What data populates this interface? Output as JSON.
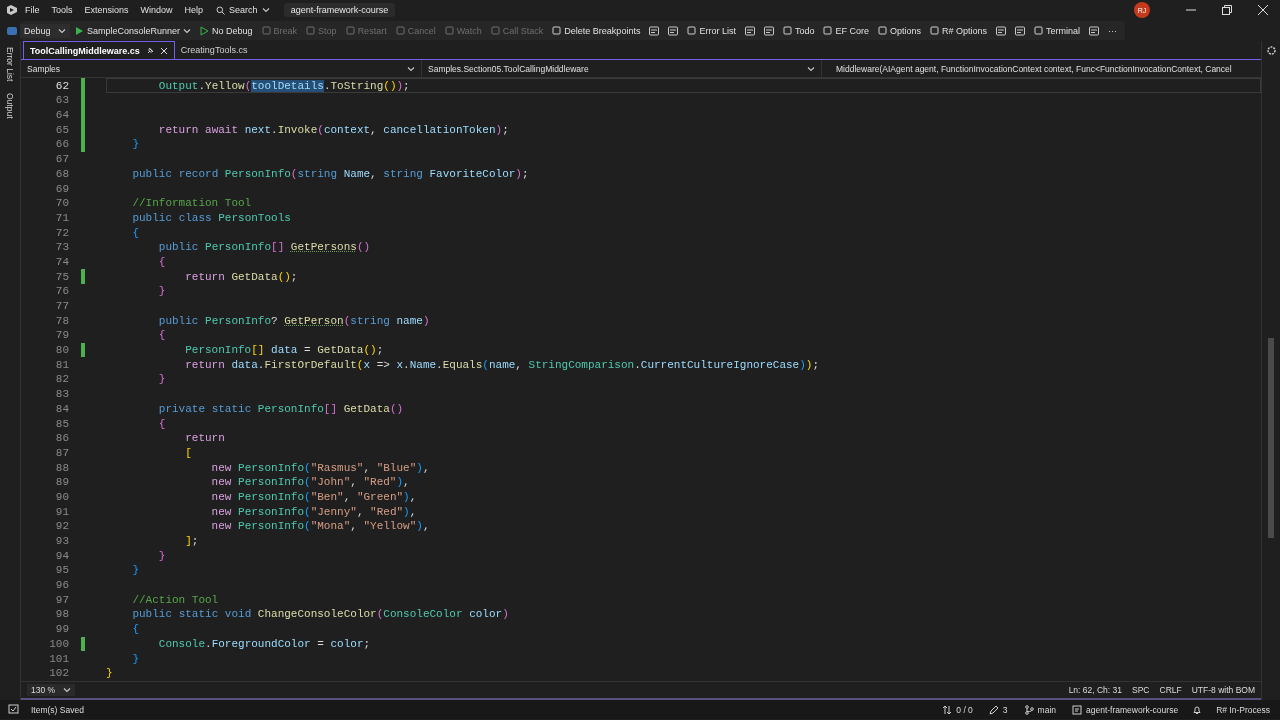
{
  "menu": {
    "items": [
      "File",
      "Tools",
      "Extensions",
      "Window",
      "Help"
    ],
    "search": "Search",
    "solution": "agent-framework-course",
    "avatar": "RJ"
  },
  "toolbar": [
    {
      "kind": "dropdown",
      "label": "Debug",
      "disabled": false
    },
    {
      "kind": "run",
      "label": "SampleConsoleRunner",
      "disabled": false
    },
    {
      "kind": "nodebug",
      "label": "No Debug",
      "disabled": false
    },
    {
      "kind": "button",
      "label": "Break",
      "disabled": true
    },
    {
      "kind": "button",
      "label": "Stop",
      "disabled": true
    },
    {
      "kind": "button",
      "label": "Restart",
      "disabled": true
    },
    {
      "kind": "button",
      "label": "Cancel",
      "disabled": true
    },
    {
      "kind": "button",
      "label": "Watch",
      "disabled": true
    },
    {
      "kind": "button",
      "label": "Call Stack",
      "disabled": true
    },
    {
      "kind": "button",
      "label": "Delete Breakpoints",
      "disabled": false
    },
    {
      "kind": "icon",
      "disabled": false
    },
    {
      "kind": "icon",
      "disabled": false
    },
    {
      "kind": "button",
      "label": "Error List",
      "disabled": false
    },
    {
      "kind": "icon",
      "disabled": false
    },
    {
      "kind": "icon",
      "disabled": false
    },
    {
      "kind": "button",
      "label": "Todo",
      "disabled": false
    },
    {
      "kind": "button",
      "label": "EF Core",
      "disabled": false
    },
    {
      "kind": "button",
      "label": "Options",
      "disabled": false
    },
    {
      "kind": "button",
      "label": "R# Options",
      "disabled": false
    },
    {
      "kind": "icon",
      "disabled": false
    },
    {
      "kind": "icon",
      "disabled": false
    },
    {
      "kind": "button",
      "label": "Terminal",
      "disabled": false
    },
    {
      "kind": "icon",
      "disabled": false
    },
    {
      "kind": "more",
      "label": "···",
      "disabled": false
    }
  ],
  "side_panels": [
    "Error List",
    "Output"
  ],
  "tabs": [
    {
      "label": "ToolCallingMiddleware.cs",
      "selected": true
    },
    {
      "label": "CreatingTools.cs",
      "selected": false
    }
  ],
  "nav": {
    "project": "Samples",
    "type": "Samples.Section05.ToolCallingMiddleware",
    "member": "Middleware(AIAgent agent, FunctionInvocationContext context, Func<FunctionInvocationContext, Cancel"
  },
  "code": [
    {
      "number": "62",
      "modified": true,
      "current": true,
      "tokens": [
        {
          "kind": "type",
          "text": "        Output"
        },
        {
          "kind": "plain",
          "text": "."
        },
        {
          "kind": "method",
          "text": "Yellow"
        },
        {
          "kind": "b2",
          "text": "("
        },
        {
          "kind": "sel",
          "text": "toolDetails"
        },
        {
          "kind": "plain",
          "text": "."
        },
        {
          "kind": "method",
          "text": "ToString"
        },
        {
          "kind": "b1",
          "text": "()"
        },
        {
          "kind": "b2",
          "text": ")"
        },
        {
          "kind": "plain",
          "text": ";"
        }
      ]
    },
    {
      "number": "63",
      "modified": true,
      "current": false
    },
    {
      "number": "64",
      "modified": true,
      "current": false
    },
    {
      "number": "65",
      "modified": true,
      "current": false,
      "tokens": [
        {
          "kind": "ctl",
          "text": "        return "
        },
        {
          "kind": "ctl",
          "text": "await "
        },
        {
          "kind": "var",
          "text": "next"
        },
        {
          "kind": "plain",
          "text": "."
        },
        {
          "kind": "method",
          "text": "Invoke"
        },
        {
          "kind": "b2",
          "text": "("
        },
        {
          "kind": "var",
          "text": "context"
        },
        {
          "kind": "plain",
          "text": ", "
        },
        {
          "kind": "var",
          "text": "cancellationToken"
        },
        {
          "kind": "b2",
          "text": ")"
        },
        {
          "kind": "plain",
          "text": ";"
        }
      ]
    },
    {
      "number": "66",
      "modified": true,
      "current": false,
      "tokens": [
        {
          "kind": "b3",
          "text": "    }"
        }
      ]
    },
    {
      "number": "67",
      "modified": false,
      "current": false
    },
    {
      "number": "68",
      "modified": false,
      "current": false,
      "tokens": [
        {
          "kind": "kw",
          "text": "    public "
        },
        {
          "kind": "kw",
          "text": "record "
        },
        {
          "kind": "type",
          "text": "PersonInfo"
        },
        {
          "kind": "b2",
          "text": "("
        },
        {
          "kind": "kw",
          "text": "string "
        },
        {
          "kind": "var",
          "text": "Name"
        },
        {
          "kind": "plain",
          "text": ", "
        },
        {
          "kind": "kw",
          "text": "string "
        },
        {
          "kind": "var",
          "text": "FavoriteColor"
        },
        {
          "kind": "b2",
          "text": ")"
        },
        {
          "kind": "plain",
          "text": ";"
        }
      ]
    },
    {
      "number": "69",
      "modified": false,
      "current": false
    },
    {
      "number": "70",
      "modified": false,
      "current": false,
      "tokens": [
        {
          "kind": "comment",
          "text": "    //Information Tool"
        }
      ]
    },
    {
      "number": "71",
      "modified": false,
      "current": false,
      "tokens": [
        {
          "kind": "kw",
          "text": "    public "
        },
        {
          "kind": "kw",
          "text": "class "
        },
        {
          "kind": "type",
          "text": "PersonTools"
        }
      ]
    },
    {
      "number": "72",
      "modified": false,
      "current": false,
      "tokens": [
        {
          "kind": "b3",
          "text": "    {"
        }
      ]
    },
    {
      "number": "73",
      "modified": false,
      "current": false,
      "tokens": [
        {
          "kind": "kw",
          "text": "        public "
        },
        {
          "kind": "type",
          "text": "PersonInfo"
        },
        {
          "kind": "b2",
          "text": "[] "
        },
        {
          "kind": "hint",
          "text": "GetPersons"
        },
        {
          "kind": "b2",
          "text": "()"
        }
      ]
    },
    {
      "number": "74",
      "modified": false,
      "current": false,
      "tokens": [
        {
          "kind": "b2",
          "text": "        {"
        }
      ]
    },
    {
      "number": "75",
      "modified": true,
      "current": false,
      "tokens": [
        {
          "kind": "ctl",
          "text": "            return "
        },
        {
          "kind": "method",
          "text": "GetData"
        },
        {
          "kind": "b1",
          "text": "()"
        },
        {
          "kind": "plain",
          "text": ";"
        }
      ]
    },
    {
      "number": "76",
      "modified": false,
      "current": false,
      "tokens": [
        {
          "kind": "b2",
          "text": "        }"
        }
      ]
    },
    {
      "number": "77",
      "modified": false,
      "current": false
    },
    {
      "number": "78",
      "modified": false,
      "current": false,
      "tokens": [
        {
          "kind": "kw",
          "text": "        public "
        },
        {
          "kind": "type",
          "text": "PersonInfo"
        },
        {
          "kind": "plain",
          "text": "? "
        },
        {
          "kind": "hint",
          "text": "GetPerson"
        },
        {
          "kind": "b2",
          "text": "("
        },
        {
          "kind": "kw",
          "text": "string "
        },
        {
          "kind": "var",
          "text": "name"
        },
        {
          "kind": "b2",
          "text": ")"
        }
      ]
    },
    {
      "number": "79",
      "modified": false,
      "current": false,
      "tokens": [
        {
          "kind": "b2",
          "text": "        {"
        }
      ]
    },
    {
      "number": "80",
      "modified": true,
      "current": false,
      "tokens": [
        {
          "kind": "type",
          "text": "            PersonInfo"
        },
        {
          "kind": "b1",
          "text": "[] "
        },
        {
          "kind": "var",
          "text": "data"
        },
        {
          "kind": "plain",
          "text": " = "
        },
        {
          "kind": "method",
          "text": "GetData"
        },
        {
          "kind": "b1",
          "text": "()"
        },
        {
          "kind": "plain",
          "text": ";"
        }
      ]
    },
    {
      "number": "81",
      "modified": false,
      "current": false,
      "tokens": [
        {
          "kind": "ctl",
          "text": "            return "
        },
        {
          "kind": "var",
          "text": "data"
        },
        {
          "kind": "plain",
          "text": "."
        },
        {
          "kind": "method",
          "text": "FirstOrDefault"
        },
        {
          "kind": "b1",
          "text": "("
        },
        {
          "kind": "var",
          "text": "x"
        },
        {
          "kind": "plain",
          "text": " => "
        },
        {
          "kind": "var",
          "text": "x"
        },
        {
          "kind": "plain",
          "text": "."
        },
        {
          "kind": "var",
          "text": "Name"
        },
        {
          "kind": "plain",
          "text": "."
        },
        {
          "kind": "method",
          "text": "Equals"
        },
        {
          "kind": "b3",
          "text": "("
        },
        {
          "kind": "var",
          "text": "name"
        },
        {
          "kind": "plain",
          "text": ", "
        },
        {
          "kind": "type",
          "text": "StringComparison"
        },
        {
          "kind": "plain",
          "text": "."
        },
        {
          "kind": "var",
          "text": "CurrentCultureIgnoreCase"
        },
        {
          "kind": "b3",
          "text": ")"
        },
        {
          "kind": "b1",
          "text": ")"
        },
        {
          "kind": "plain",
          "text": ";"
        }
      ]
    },
    {
      "number": "82",
      "modified": false,
      "current": false,
      "tokens": [
        {
          "kind": "b2",
          "text": "        }"
        }
      ]
    },
    {
      "number": "83",
      "modified": false,
      "current": false
    },
    {
      "number": "84",
      "modified": false,
      "current": false,
      "tokens": [
        {
          "kind": "kw",
          "text": "        private "
        },
        {
          "kind": "kw",
          "text": "static "
        },
        {
          "kind": "type",
          "text": "PersonInfo"
        },
        {
          "kind": "b2",
          "text": "[] "
        },
        {
          "kind": "method",
          "text": "GetData"
        },
        {
          "kind": "b2",
          "text": "()"
        }
      ]
    },
    {
      "number": "85",
      "modified": false,
      "current": false,
      "tokens": [
        {
          "kind": "b2",
          "text": "        {"
        }
      ]
    },
    {
      "number": "86",
      "modified": false,
      "current": false,
      "tokens": [
        {
          "kind": "ctl",
          "text": "            return"
        }
      ]
    },
    {
      "number": "87",
      "modified": false,
      "current": false,
      "tokens": [
        {
          "kind": "b1",
          "text": "            ["
        }
      ]
    },
    {
      "number": "88",
      "modified": false,
      "current": false,
      "tokens": [
        {
          "kind": "ctl",
          "text": "                new "
        },
        {
          "kind": "type",
          "text": "PersonInfo"
        },
        {
          "kind": "b3",
          "text": "("
        },
        {
          "kind": "str",
          "text": "\"Rasmus\""
        },
        {
          "kind": "plain",
          "text": ", "
        },
        {
          "kind": "str",
          "text": "\"Blue\""
        },
        {
          "kind": "b3",
          "text": ")"
        },
        {
          "kind": "plain",
          "text": ","
        }
      ]
    },
    {
      "number": "89",
      "modified": false,
      "current": false,
      "tokens": [
        {
          "kind": "ctl",
          "text": "                new "
        },
        {
          "kind": "type",
          "text": "PersonInfo"
        },
        {
          "kind": "b3",
          "text": "("
        },
        {
          "kind": "str",
          "text": "\"John\""
        },
        {
          "kind": "plain",
          "text": ", "
        },
        {
          "kind": "str",
          "text": "\"Red\""
        },
        {
          "kind": "b3",
          "text": ")"
        },
        {
          "kind": "plain",
          "text": ","
        }
      ]
    },
    {
      "number": "90",
      "modified": false,
      "current": false,
      "tokens": [
        {
          "kind": "ctl",
          "text": "                new "
        },
        {
          "kind": "type",
          "text": "PersonInfo"
        },
        {
          "kind": "b3",
          "text": "("
        },
        {
          "kind": "str",
          "text": "\"Ben\""
        },
        {
          "kind": "plain",
          "text": ", "
        },
        {
          "kind": "str",
          "text": "\"Green\""
        },
        {
          "kind": "b3",
          "text": ")"
        },
        {
          "kind": "plain",
          "text": ","
        }
      ]
    },
    {
      "number": "91",
      "modified": false,
      "current": false,
      "tokens": [
        {
          "kind": "ctl",
          "text": "                new "
        },
        {
          "kind": "type",
          "text": "PersonInfo"
        },
        {
          "kind": "b3",
          "text": "("
        },
        {
          "kind": "str",
          "text": "\"Jenny\""
        },
        {
          "kind": "plain",
          "text": ", "
        },
        {
          "kind": "str",
          "text": "\"Red\""
        },
        {
          "kind": "b3",
          "text": ")"
        },
        {
          "kind": "plain",
          "text": ","
        }
      ]
    },
    {
      "number": "92",
      "modified": false,
      "current": false,
      "tokens": [
        {
          "kind": "ctl",
          "text": "                new "
        },
        {
          "kind": "type",
          "text": "PersonInfo"
        },
        {
          "kind": "b3",
          "text": "("
        },
        {
          "kind": "str",
          "text": "\"Mona\""
        },
        {
          "kind": "plain",
          "text": ", "
        },
        {
          "kind": "str",
          "text": "\"Yellow\""
        },
        {
          "kind": "b3",
          "text": ")"
        },
        {
          "kind": "plain",
          "text": ","
        }
      ]
    },
    {
      "number": "93",
      "modified": false,
      "current": false,
      "tokens": [
        {
          "kind": "b1",
          "text": "            ]"
        },
        {
          "kind": "plain",
          "text": ";"
        }
      ]
    },
    {
      "number": "94",
      "modified": false,
      "current": false,
      "tokens": [
        {
          "kind": "b2",
          "text": "        }"
        }
      ]
    },
    {
      "number": "95",
      "modified": false,
      "current": false,
      "tokens": [
        {
          "kind": "b3",
          "text": "    }"
        }
      ]
    },
    {
      "number": "96",
      "modified": false,
      "current": false
    },
    {
      "number": "97",
      "modified": false,
      "current": false,
      "tokens": [
        {
          "kind": "comment",
          "text": "    //Action Tool"
        }
      ]
    },
    {
      "number": "98",
      "modified": false,
      "current": false,
      "tokens": [
        {
          "kind": "kw",
          "text": "    public "
        },
        {
          "kind": "kw",
          "text": "static "
        },
        {
          "kind": "kw",
          "text": "void "
        },
        {
          "kind": "method",
          "text": "ChangeConsoleColor"
        },
        {
          "kind": "b2",
          "text": "("
        },
        {
          "kind": "type",
          "text": "ConsoleColor "
        },
        {
          "kind": "var",
          "text": "color"
        },
        {
          "kind": "b2",
          "text": ")"
        }
      ]
    },
    {
      "number": "99",
      "modified": false,
      "current": false,
      "tokens": [
        {
          "kind": "b3",
          "text": "    {"
        }
      ]
    },
    {
      "number": "100",
      "modified": true,
      "current": false,
      "tokens": [
        {
          "kind": "type",
          "text": "        Console"
        },
        {
          "kind": "plain",
          "text": "."
        },
        {
          "kind": "var",
          "text": "ForegroundColor"
        },
        {
          "kind": "plain",
          "text": " = "
        },
        {
          "kind": "var",
          "text": "color"
        },
        {
          "kind": "plain",
          "text": ";"
        }
      ]
    },
    {
      "number": "101",
      "modified": false,
      "current": false,
      "tokens": [
        {
          "kind": "b3",
          "text": "    }"
        }
      ]
    },
    {
      "number": "102",
      "modified": false,
      "current": false,
      "tokens": [
        {
          "kind": "b1",
          "text": "}"
        }
      ]
    }
  ],
  "editor_status": {
    "zoom": "130 %",
    "position": "Ln: 62, Ch: 31",
    "indent": "SPC",
    "line_endings": "CRLF",
    "encoding": "UTF-8 with BOM"
  },
  "status_bar": {
    "message": "Item(s) Saved",
    "sync": "0 / 0",
    "changes": "3",
    "branch": "main",
    "repository": "agent-framework-course",
    "resharper": "R# In-Process"
  }
}
